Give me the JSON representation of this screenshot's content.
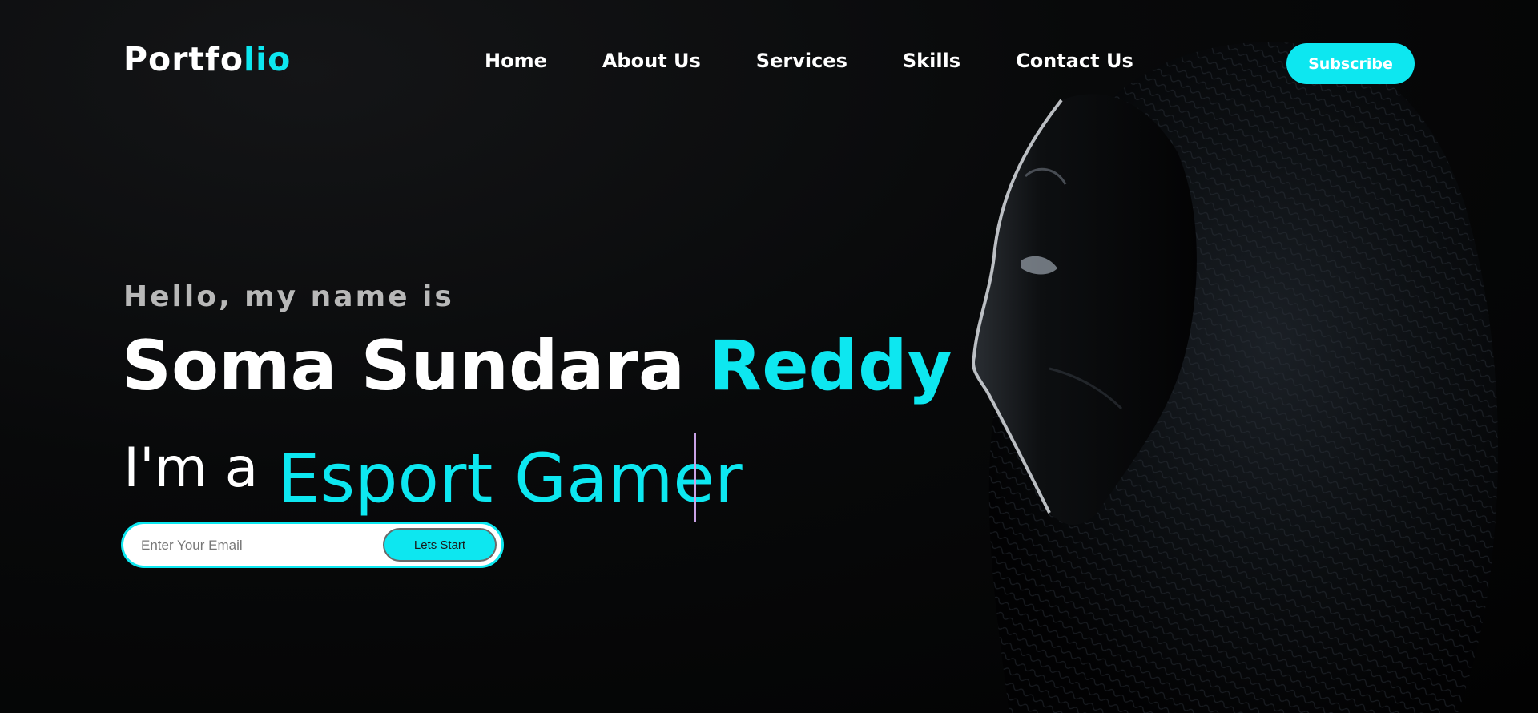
{
  "logo": {
    "text_main": "Portfo",
    "text_accent": "lio"
  },
  "nav": {
    "items": [
      "Home",
      "About Us",
      "Services",
      "Skills",
      "Contact Us"
    ]
  },
  "subscribe": {
    "label": "Subscribe"
  },
  "hero": {
    "greeting": "Hello, my name is",
    "name_main": "Soma Sundara ",
    "name_accent": "Reddy",
    "role_prefix": "I'm a",
    "role_text": "Esport Gamer"
  },
  "email_form": {
    "placeholder": "Enter Your Email",
    "value": "",
    "button_label": "Lets Start"
  },
  "colors": {
    "accent": "#0de7f0",
    "background": "#050505",
    "text": "#ffffff",
    "muted": "#b8b8b8",
    "cursor": "#c9a2e6"
  },
  "icons": [
    "hooded-mask-figure"
  ]
}
